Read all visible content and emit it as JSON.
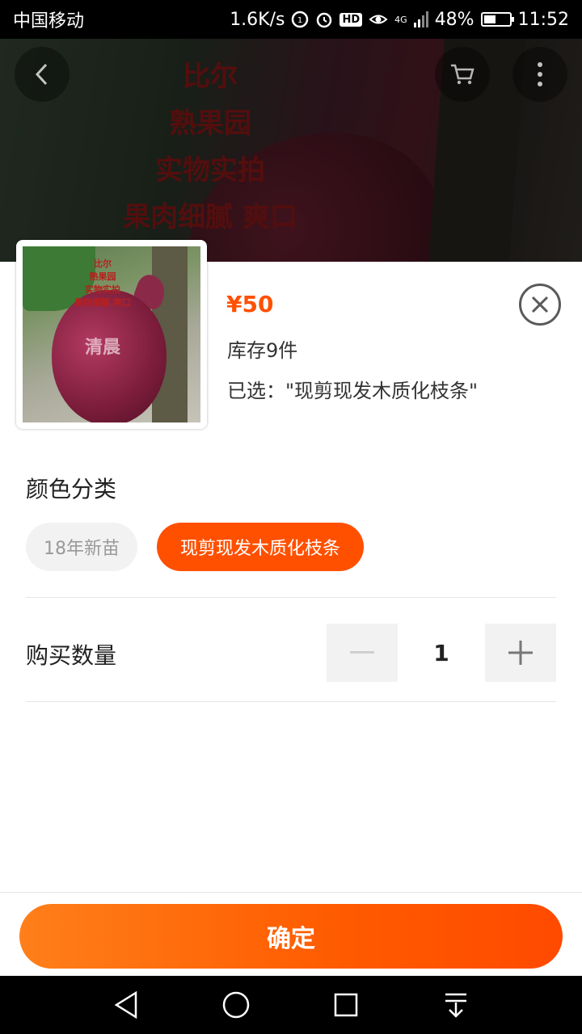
{
  "status_bar": {
    "carrier": "中国移动",
    "net_speed": "1.6K/s",
    "hd": "HD",
    "net_type": "4G",
    "battery": "48%",
    "battery_level": 0.48,
    "time": "11:52"
  },
  "hero": {
    "overlay_text": [
      "比尔",
      "熟果园",
      "实物实拍",
      "果肉细腻 爽口"
    ],
    "icons": {
      "back": "back-arrow-icon",
      "cart": "cart-icon",
      "more": "more-vertical-icon"
    }
  },
  "thumbnail": {
    "overlay_text": [
      "比尔",
      "熟果园",
      "实物实拍",
      "果肉细腻 爽口",
      "清晨"
    ]
  },
  "product": {
    "price": "¥50",
    "stock": "库存9件",
    "selected": "已选：\"现剪现发木质化枝条\""
  },
  "variants": {
    "title": "颜色分类",
    "options": [
      {
        "label": "18年新苗",
        "selected": false
      },
      {
        "label": "现剪现发木质化枝条",
        "selected": true
      }
    ]
  },
  "quantity": {
    "label": "购买数量",
    "value": "1"
  },
  "confirm_label": "确定",
  "colors": {
    "accent": "#ff5000"
  }
}
